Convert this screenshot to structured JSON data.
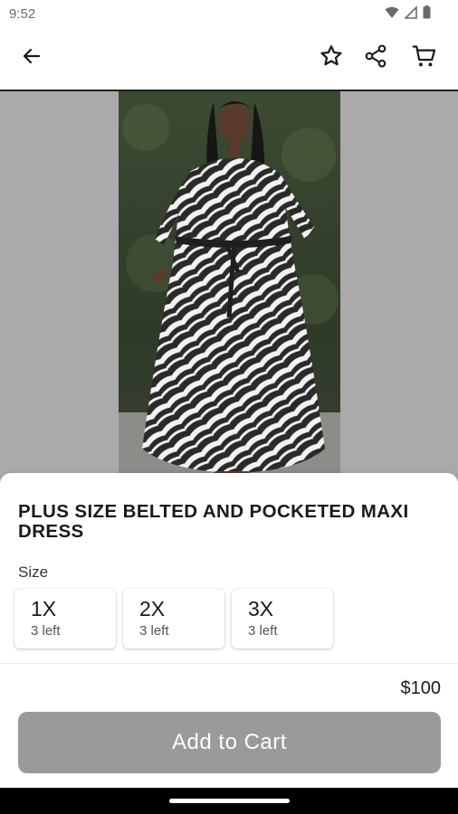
{
  "status_bar": {
    "time": "9:52",
    "icons": [
      "wifi-icon",
      "signal-icon",
      "battery-icon"
    ]
  },
  "app_bar": {
    "icons": [
      "back-arrow-icon",
      "star-icon",
      "share-icon",
      "cart-icon"
    ]
  },
  "product": {
    "title": "PLUS SIZE BELTED AND POCKETED MAXI DRESS",
    "image_alt": "Model wearing black and white zebra print maxi dress",
    "size_label": "Size",
    "sizes": [
      {
        "name": "1X",
        "stock": "3 left"
      },
      {
        "name": "2X",
        "stock": "3 left"
      },
      {
        "name": "3X",
        "stock": "3 left"
      }
    ],
    "price": "$100"
  },
  "actions": {
    "add_to_cart": "Add to Cart"
  },
  "colors": {
    "hero_background": "#aaaaaa",
    "button_disabled": "#9a9a9a",
    "dress_black": "#2a2a2a",
    "dress_white": "#f2f2f2"
  }
}
